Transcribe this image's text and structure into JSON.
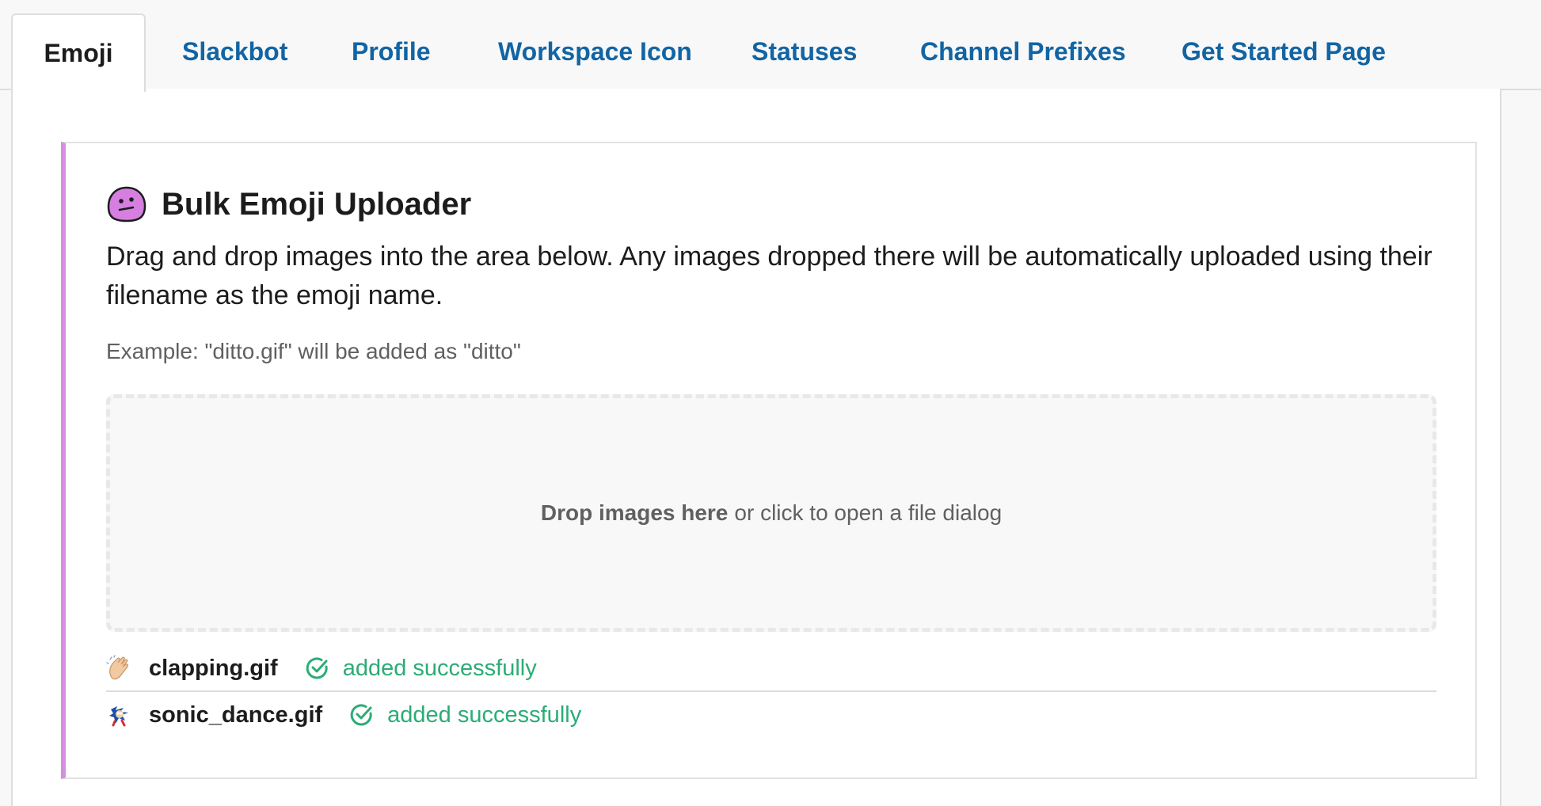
{
  "tabs": [
    {
      "label": "Emoji",
      "active": true
    },
    {
      "label": "Slackbot",
      "active": false
    },
    {
      "label": "Profile",
      "active": false
    },
    {
      "label": "Workspace Icon",
      "active": false
    },
    {
      "label": "Statuses",
      "active": false
    },
    {
      "label": "Channel Prefixes",
      "active": false
    },
    {
      "label": "Get Started Page",
      "active": false
    }
  ],
  "uploader": {
    "icon": "confused-blob-icon",
    "title": "Bulk Emoji Uploader",
    "description": "Drag and drop images into the area below. Any images dropped there will be automatically uploaded using their filename as the emoji name.",
    "example": "Example: \"ditto.gif\" will be added as \"ditto\"",
    "dropzone": {
      "bold": "Drop images here",
      "rest": "or click to open a file dialog"
    },
    "results": [
      {
        "icon": "clapping-hands-icon",
        "filename": "clapping.gif",
        "status": "added successfully"
      },
      {
        "icon": "sonic-dance-icon",
        "filename": "sonic_dance.gif",
        "status": "added successfully"
      }
    ]
  },
  "colors": {
    "link": "#1264a3",
    "accent_border": "#d48fe0",
    "success": "#2bac76"
  }
}
